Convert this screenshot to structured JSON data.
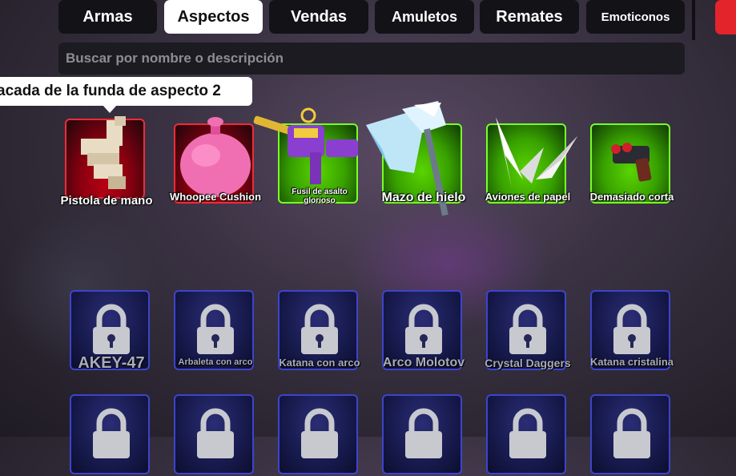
{
  "tabs": [
    {
      "label": "Armas",
      "active": false
    },
    {
      "label": "Aspectos",
      "active": true
    },
    {
      "label": "Vendas",
      "active": false
    },
    {
      "label": "Amuletos",
      "active": false
    },
    {
      "label": "Remates",
      "active": false
    },
    {
      "label": "Emoticonos",
      "active": false
    }
  ],
  "search": {
    "placeholder": "Buscar por nombre o descripción"
  },
  "tooltip": {
    "text": "acada de la funda de aspecto 2"
  },
  "unlocked_items": [
    {
      "name": "Pistola de mano",
      "rarity": "red",
      "icon": "hand-gun-icon"
    },
    {
      "name": "Whoopee Cushion",
      "rarity": "red",
      "icon": "whoopee-cushion-icon"
    },
    {
      "name": "Fusil de asalto glorioso",
      "rarity": "green",
      "icon": "glorious-rifle-icon"
    },
    {
      "name": "Mazo de hielo",
      "rarity": "green",
      "icon": "ice-axe-icon"
    },
    {
      "name": "Aviones de papel",
      "rarity": "green",
      "icon": "paper-planes-icon"
    },
    {
      "name": "Demasiado corta",
      "rarity": "green",
      "icon": "short-shotgun-icon"
    }
  ],
  "locked_items": [
    {
      "name": "AKEY-47",
      "icon": "lock-icon"
    },
    {
      "name": "Arbaleta con arco",
      "icon": "lock-icon"
    },
    {
      "name": "Katana con arco",
      "icon": "lock-icon"
    },
    {
      "name": "Arco Molotov",
      "icon": "lock-icon"
    },
    {
      "name": "Crystal Daggers",
      "icon": "lock-icon"
    },
    {
      "name": "Katana cristalina",
      "icon": "lock-icon"
    }
  ],
  "colors": {
    "accent_red": "#e3242b",
    "rarity_red": "#f12a3a",
    "rarity_green": "#7aff23",
    "locked_blue": "#3d44cc"
  }
}
